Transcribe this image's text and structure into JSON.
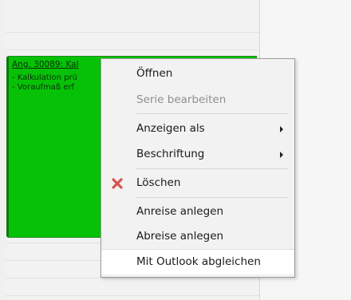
{
  "appointment": {
    "title": "Ang. 30089: Kal",
    "lines": [
      "- Kalkulation prü",
      "- Voraufmaß erf"
    ]
  },
  "menu": {
    "items": [
      {
        "label": "Öffnen",
        "enabled": true
      },
      {
        "label": "Serie bearbeiten",
        "enabled": false
      },
      {
        "label": "Anzeigen als",
        "submenu": true
      },
      {
        "label": "Beschriftung",
        "submenu": true
      },
      {
        "label": "Löschen",
        "icon": "delete-x-icon"
      },
      {
        "label": "Anreise anlegen"
      },
      {
        "label": "Abreise anlegen"
      },
      {
        "label": "Mit Outlook abgleichen",
        "highlighted": true
      }
    ]
  },
  "colors": {
    "appointment_green": "#07c107",
    "delete_icon_red": "#d9534f"
  }
}
